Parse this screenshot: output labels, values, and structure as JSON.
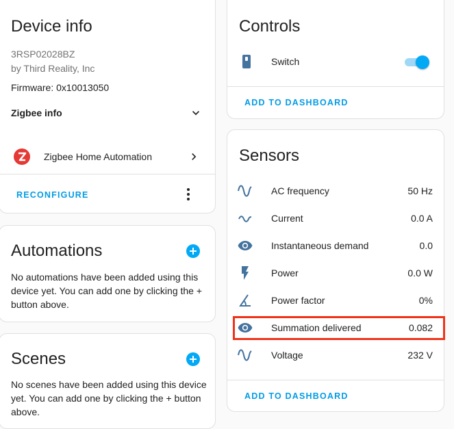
{
  "device_info": {
    "title": "Device info",
    "model": "3RSP02028BZ",
    "manufacturer": "by Third Reality, Inc",
    "firmware": "Firmware: 0x10013050",
    "zigbee_info_label": "Zigbee info",
    "integration_label": "Zigbee Home Automation",
    "reconfigure_label": "RECONFIGURE"
  },
  "automations": {
    "title": "Automations",
    "empty_text": "No automations have been added using this device yet. You can add one by clicking the + button above."
  },
  "scenes": {
    "title": "Scenes",
    "empty_text": "No scenes have been added using this device yet. You can add one by clicking the + button above."
  },
  "controls": {
    "title": "Controls",
    "items": [
      {
        "label": "Switch",
        "icon": "switch-icon",
        "state": "on"
      }
    ],
    "add_to_dashboard": "ADD TO DASHBOARD"
  },
  "sensors": {
    "title": "Sensors",
    "items": [
      {
        "label": "AC frequency",
        "value": "50 Hz",
        "icon": "sine-wave-icon"
      },
      {
        "label": "Current",
        "value": "0.0 A",
        "icon": "current-ac-icon"
      },
      {
        "label": "Instantaneous demand",
        "value": "0.0",
        "icon": "eye-icon"
      },
      {
        "label": "Power",
        "value": "0.0 W",
        "icon": "flash-icon"
      },
      {
        "label": "Power factor",
        "value": "0%",
        "icon": "angle-acute-icon"
      },
      {
        "label": "Summation delivered",
        "value": "0.082",
        "icon": "eye-icon"
      },
      {
        "label": "Voltage",
        "value": "232 V",
        "icon": "sine-wave-icon"
      }
    ],
    "add_to_dashboard": "ADD TO DASHBOARD"
  },
  "colors": {
    "accent": "#03a9f4",
    "action_text": "#039be5",
    "icon": "#44739e",
    "highlight": "#f03219",
    "zha_red": "#e53935"
  }
}
